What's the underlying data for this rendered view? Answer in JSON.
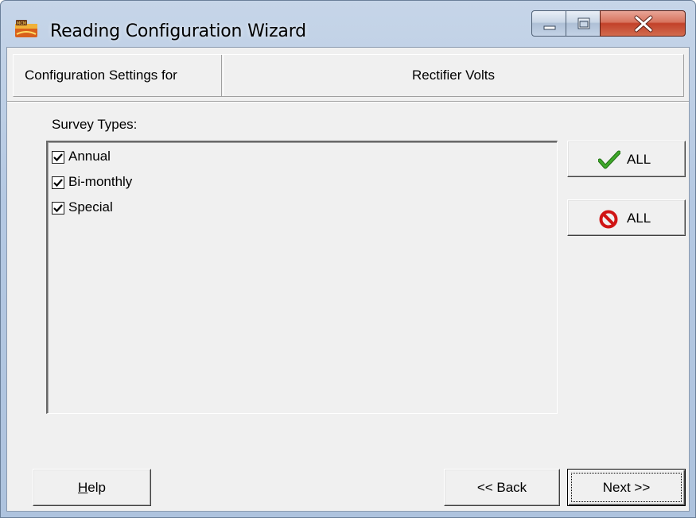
{
  "window": {
    "title": "Reading Configuration Wizard",
    "app_icon": "mcm-app-icon",
    "controls": [
      "minimize-icon",
      "maximize-icon",
      "close-icon"
    ]
  },
  "header": {
    "label": "Configuration Settings for",
    "value": "Rectifier Volts"
  },
  "survey": {
    "label": "Survey Types:",
    "items": [
      {
        "label": "Annual",
        "checked": true
      },
      {
        "label": "Bi-monthly",
        "checked": true
      },
      {
        "label": "Special",
        "checked": true
      }
    ]
  },
  "side_buttons": {
    "select_all": {
      "label": "ALL",
      "icon": "checkmark-icon",
      "color": "#2a8a1a"
    },
    "clear_all": {
      "label": "ALL",
      "icon": "no-sign-icon",
      "color": "#d01515"
    }
  },
  "footer": {
    "help_label": "Help",
    "help_mnemonic": "H",
    "help_rest": "elp",
    "back_label": "<< Back",
    "next_label": "Next >>"
  },
  "colors": {
    "client_bg": "#f0f0f0",
    "titlebar": "#b9cce4",
    "close_button": "#c7432b"
  }
}
